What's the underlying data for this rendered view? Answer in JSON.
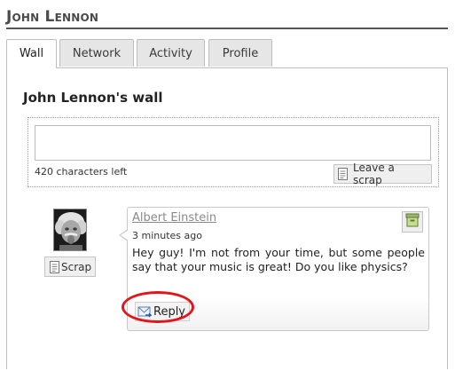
{
  "header": {
    "title": "John Lennon"
  },
  "tabs": [
    {
      "label": "Wall",
      "active": true
    },
    {
      "label": "Network",
      "active": false
    },
    {
      "label": "Activity",
      "active": false
    },
    {
      "label": "Profile",
      "active": false
    }
  ],
  "wall": {
    "title": "John Lennon's wall",
    "compose": {
      "value": "",
      "chars_left": "420 characters left",
      "leave_scrap_label": "Leave a scrap"
    }
  },
  "scraps": [
    {
      "scrap_button_label": "Scrap",
      "author": "Albert Einstein",
      "time": "3 minutes ago",
      "text": "Hey guy! I'm not from your time, but some people say that your music is great! Do you like physics?",
      "reply_label": "Reply"
    }
  ],
  "icons": {
    "scrap": "document-icon",
    "archive": "archive-box-icon",
    "reply": "mail-reply-icon"
  },
  "colors": {
    "highlight": "#e3151b",
    "title_rule": "#555555"
  }
}
